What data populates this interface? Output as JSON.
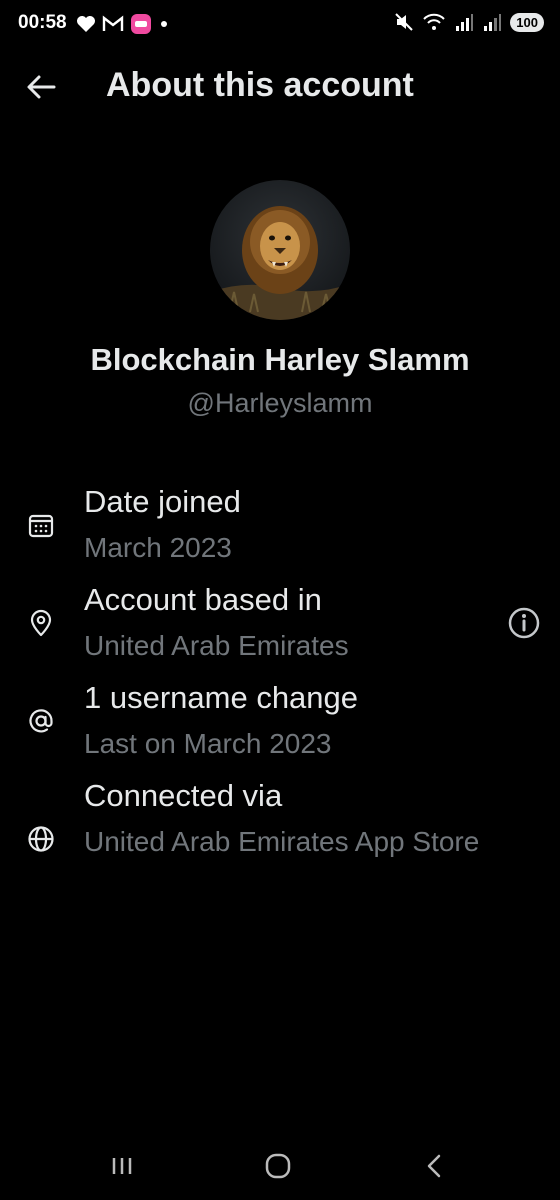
{
  "status_bar": {
    "time": "00:58",
    "battery": "100",
    "left_icons": [
      "heart-icon",
      "gmail-icon",
      "app-notification-icon",
      "dot-icon"
    ],
    "right_icons": [
      "mute-icon",
      "wifi-icon",
      "signal-icon",
      "signal-roaming-icon"
    ]
  },
  "header": {
    "title": "About this account",
    "back_icon": "arrow-left-icon"
  },
  "profile": {
    "display_name": "Blockchain Harley Slamm",
    "handle": "@Harleyslamm",
    "avatar_image": "lion-avatar"
  },
  "info": [
    {
      "icon": "calendar-icon",
      "label": "Date joined",
      "value": "March 2023"
    },
    {
      "icon": "location-pin-icon",
      "label": "Account based in",
      "value": "United Arab Emirates"
    },
    {
      "icon": "at-sign-icon",
      "label": "1 username change",
      "value": "Last on March 2023"
    },
    {
      "icon": "globe-icon",
      "label": "Connected via",
      "value": "United Arab Emirates App Store"
    }
  ],
  "colors": {
    "background": "#000000",
    "primary_text": "#e7e9ea",
    "secondary_text": "#71767b",
    "notification_badge": "#f04aa0"
  },
  "nav_bar": [
    "recent-apps-icon",
    "home-icon",
    "back-icon"
  ]
}
